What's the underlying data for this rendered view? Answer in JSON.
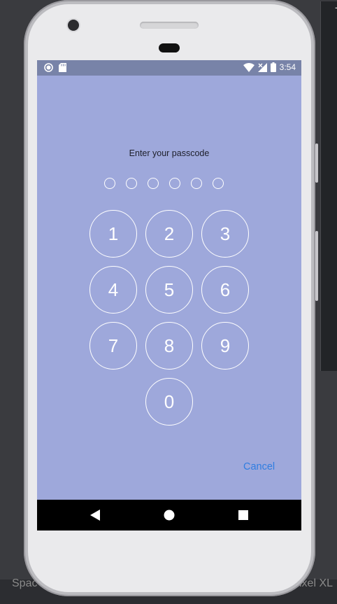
{
  "status_bar": {
    "time": "3:54",
    "left_icons": [
      "circle-notification-icon",
      "sd-card-icon"
    ],
    "right_icons": [
      "wifi-icon",
      "cell-signal-icon",
      "battery-icon"
    ]
  },
  "lock_screen": {
    "prompt": "Enter your passcode",
    "passcode_length": 6,
    "keys": [
      "1",
      "2",
      "3",
      "4",
      "5",
      "6",
      "7",
      "8",
      "9",
      "0"
    ],
    "cancel_label": "Cancel"
  },
  "nav_bar": {
    "buttons": [
      "back-icon",
      "home-icon",
      "recents-icon"
    ]
  },
  "background": {
    "bottom_left_text": "Spac",
    "bottom_right_text": "ixel XL"
  },
  "colors": {
    "screen_bg": "#9ea8db",
    "status_bar_bg": "#7883a8",
    "accent": "#2f7de1",
    "key_stroke": "#ffffff"
  }
}
